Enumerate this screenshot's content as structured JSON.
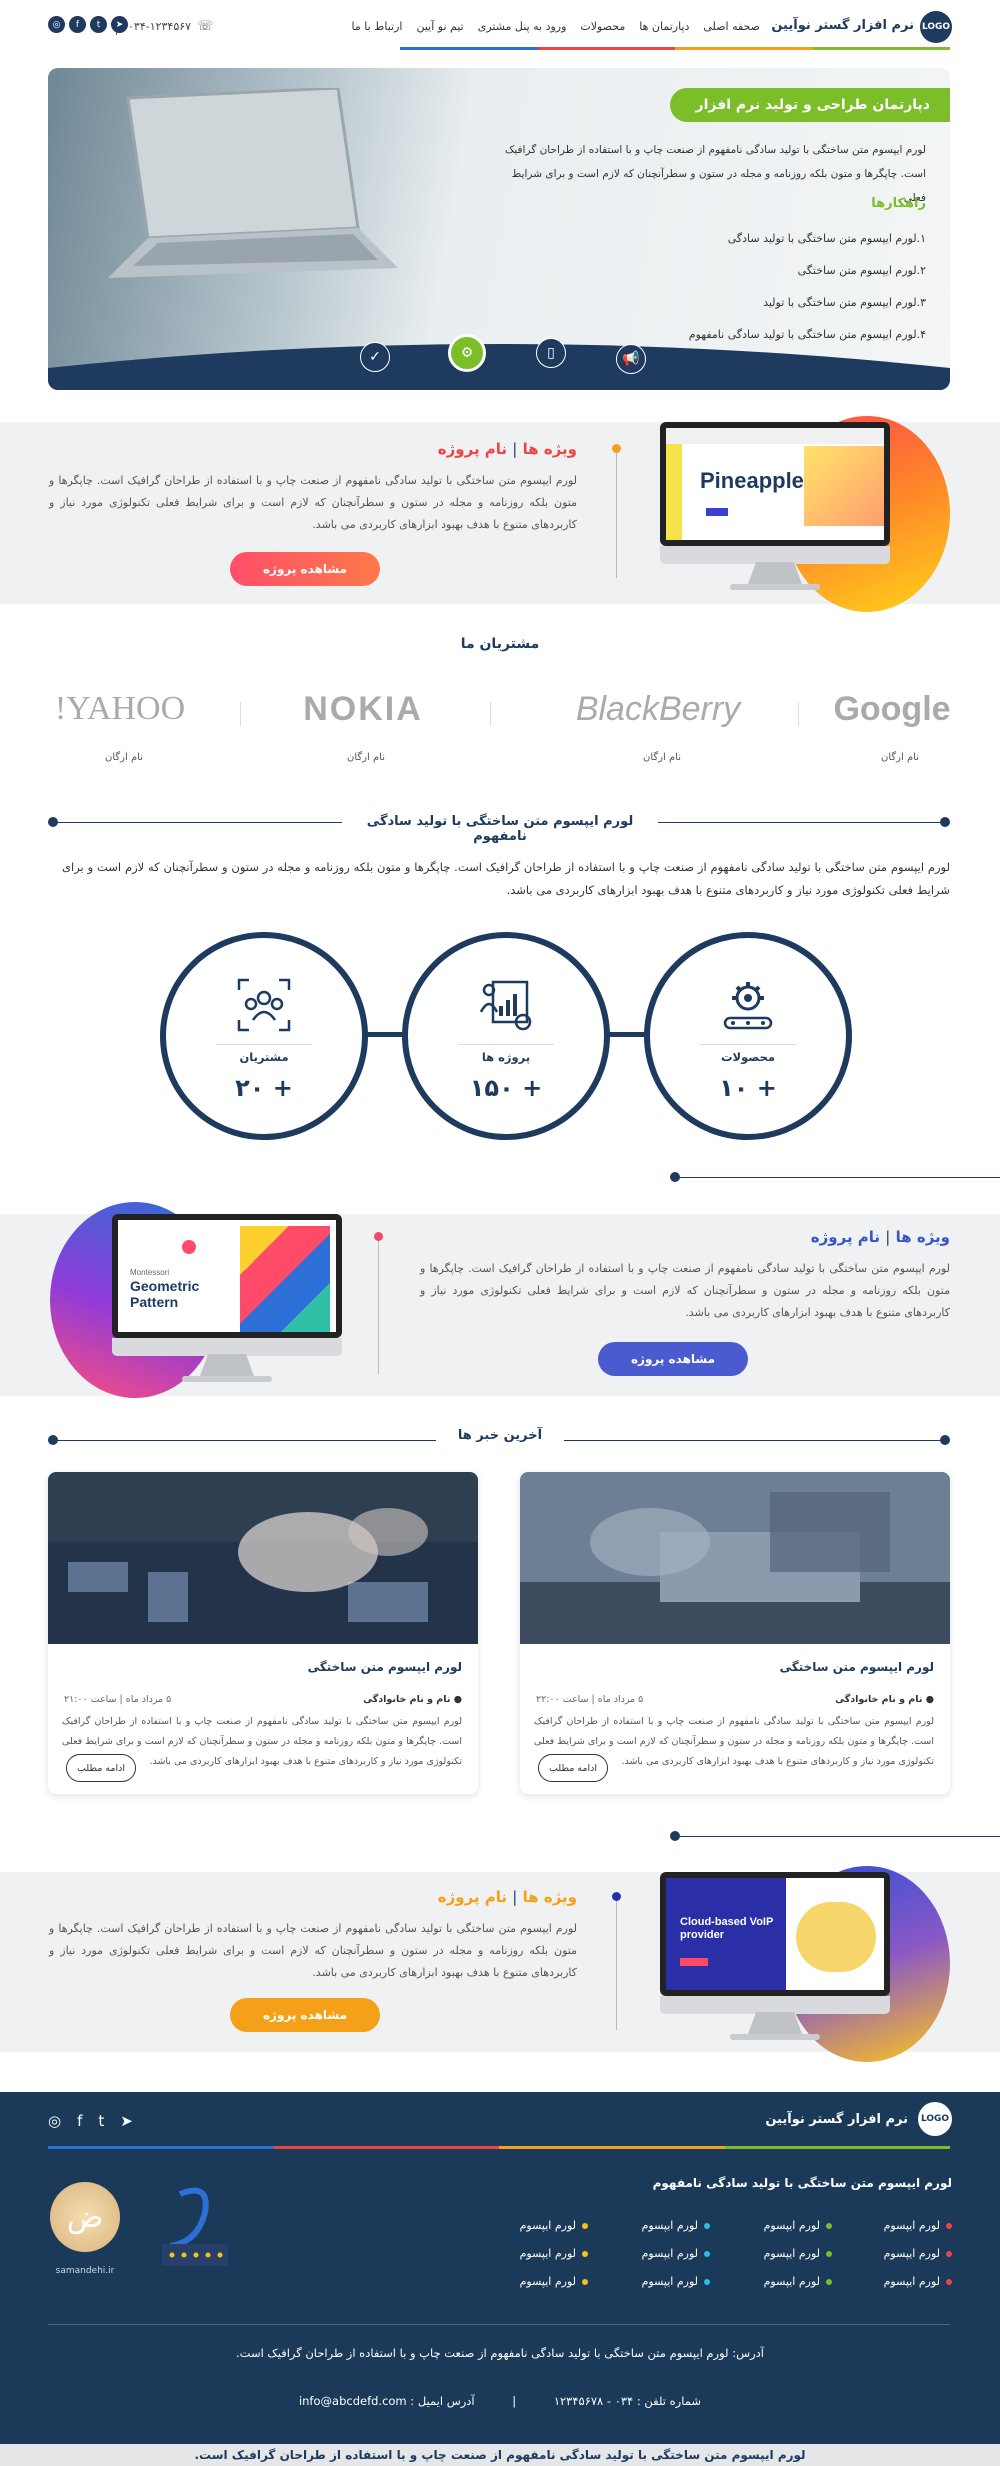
{
  "header": {
    "logo": "LOGO",
    "brand": "نرم افزار گستر نوآیین",
    "nav": [
      "صحفه اصلی",
      "دپارتمان ها",
      "محصولات",
      "ورود به پنل مشتری",
      "تیم نو آیین",
      "ارتباط با ما"
    ],
    "phone": "۰۳۴-۱۲۳۴۵۶۷",
    "socials": [
      "instagram-icon",
      "facebook-icon",
      "twitter-icon",
      "telegram-icon"
    ]
  },
  "brand_colors": {
    "navy": "#1e3a5f",
    "green": "#7cbd2a",
    "orange": "#f4a019",
    "red": "#ee4444",
    "blue": "#2d6fd6",
    "purple": "#4a5bd0"
  },
  "hero": {
    "title": "دپارتمان طراحی و تولید نرم افزار",
    "text": "لورم ایپسوم متن ساختگی با تولید سادگی نامفهوم از صنعت چاپ و با استفاده از طراحان گرافیک است. چاپگرها و متون بلکه روزنامه و مجله در ستون و سطرآنچنان که لازم است و برای شرایط فعلی",
    "subtitle": "راهکارها",
    "list": [
      "۱.لورم ایپسوم متن ساختگی با تولید سادگی",
      "۲.لورم ایپسوم متن ساختگی",
      "۳.لورم ایپسوم متن ساختگی با تولید",
      "۴.لورم ایپسوم متن ساختگی با تولید سادگی نامفهوم"
    ]
  },
  "projects": [
    {
      "title": "ویژه ها",
      "sep": "|",
      "name": "نام پروژه",
      "text": "لورم ایپسوم متن ساختگی با تولید سادگی نامفهوم از صنعت چاپ و با استفاده از طراحان گرافیک است. چاپگرها و متون بلکه روزنامه و مجله در ستون و سطرآنچنان که لازم است و برای شرایط فعلی تکنولوژی مورد نیاز و کاربردهای متنوع با هدف بهبود ابزارهای کاربردی می باشد.",
      "button": "مشاهده پروژه",
      "screen": "Pineapple"
    },
    {
      "title": "ویژه ها",
      "sep": "|",
      "name": "نام پروژه",
      "text": "لورم ایپسوم متن ساختگی با تولید سادگی نامفهوم از صنعت چاپ و با استفاده از طراحان گرافیک است. چاپگرها و متون بلکه روزنامه و مجله در ستون و سطرآنچنان که لازم است و برای شرایط فعلی تکنولوژی مورد نیاز و کاربردهای متنوع با هدف بهبود ابزارهای کاربردی می باشد.",
      "button": "مشاهده پروژه",
      "screen": "Geometric Pattern",
      "screen_sub": "Montessori"
    },
    {
      "title": "ویژه ها",
      "sep": "|",
      "name": "نام پروژه",
      "text": "لورم ایپسوم متن ساختگی با تولید سادگی نامفهوم از صنعت چاپ و با استفاده از طراحان گرافیک است. چاپگرها و متون بلکه روزنامه و مجله در ستون و سطرآنچنان که لازم است و برای شرایط فعلی تکنولوژی مورد نیاز و کاربردهای متنوع با هدف بهبود ابزارهای کاربردی می باشد.",
      "button": "مشاهده پروژه",
      "screen": "Cloud-based VoIP provider"
    }
  ],
  "customers": {
    "title": "مشتریان ما",
    "logos": [
      "Google",
      "BlackBerry",
      "NOKIA",
      "YAHOO!"
    ],
    "names": [
      "نام ارگان",
      "نام ارگان",
      "نام ارگان",
      "نام ارگان"
    ]
  },
  "about": {
    "title": "لورم ایپسوم متن ساختگی با تولید سادگی نامفهوم",
    "text": "لورم ایپسوم متن ساختگی با تولید سادگی نامفهوم از صنعت چاپ و با استفاده از طراحان گرافیک است. چاپگرها و متون بلکه روزنامه و مجله در ستون و سطرآنچنان که لازم است و برای شرایط فعلی تکنولوژی مورد نیاز و کاربردهای متنوع با هدف بهبود ابزارهای کاربردی می باشد."
  },
  "stats": [
    {
      "label": "محصولات",
      "value": "+ ۱۰",
      "icon": "gear-conveyor-icon"
    },
    {
      "label": "پروژه ها",
      "value": "+ ۱۵۰",
      "icon": "project-team-icon"
    },
    {
      "label": "مشتریان",
      "value": "+ ۲۰",
      "icon": "customers-target-icon"
    }
  ],
  "news": {
    "title": "آخرین خبر ها",
    "items": [
      {
        "title": "لورم ایپسوم متن ساختگی",
        "author": "نام و نام خانوادگی",
        "date": "۵ مرداد ماه | ساعت ۲۲:۰۰",
        "text": "لورم ایپسوم متن ساختگی با تولید سادگی نامفهوم از صنعت چاپ و با استفاده از طراحان گرافیک است. چاپگرها و متون بلکه روزنامه و مجله در ستون و سطرآنچنان که لازم است و برای شرایط فعلی تکنولوژی مورد نیاز و کاربردهای متنوع با هدف بهبود ابزارهای کاربردی می باشد.",
        "more": "ادامه مطلب"
      },
      {
        "title": "لورم ایپسوم متن ساختگی",
        "author": "نام و نام خانوادگی",
        "date": "۵ مرداد ماه | ساعت ۲۱:۰۰",
        "text": "لورم ایپسوم متن ساختگی با تولید سادگی نامفهوم از صنعت چاپ و با استفاده از طراحان گرافیک است. چاپگرها و متون بلکه روزنامه و مجله در ستون و سطرآنچنان که لازم است و برای شرایط فعلی تکنولوژی مورد نیاز و کاربردهای متنوع با هدف بهبود ابزارهای کاربردی می باشد.",
        "more": "ادامه مطلب"
      }
    ]
  },
  "footer": {
    "logo": "LOGO",
    "brand": "نرم افزار گستر نوآیین",
    "socials": [
      "instagram-icon",
      "facebook-icon",
      "twitter-icon",
      "telegram-icon"
    ],
    "subtitle": "لورم ایپسوم متن ساختگی با تولید سادگی نامفهوم",
    "link": "لورم ایپسوم",
    "badges": [
      "samandehi-seal-icon",
      "enamad-seal-icon"
    ],
    "badge_text": "samandehi.ir",
    "address": "آدرس: لورم ایپسوم متن ساختگی با تولید سادگی نامفهوم از صنعت چاپ و با استفاده از طراحان گرافیک است.",
    "phone_label": "شماره تلفن :",
    "phone": "۰۳۴ - ۱۲۳۴۵۶۷۸",
    "email_label": "آدرس ایمیل :",
    "email": "info@abcdefd.com",
    "bottom": "لورم ایپسوم متن ساختگی با تولید سادگی نامفهوم از صنعت چاپ و با استفاده از طراحان گرافیک است."
  }
}
